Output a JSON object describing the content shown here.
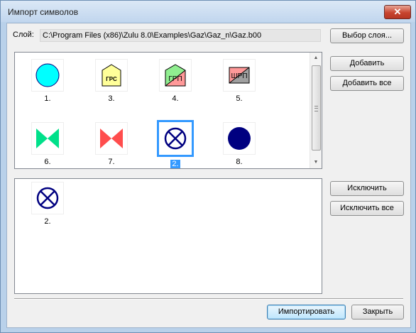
{
  "window": {
    "title": "Импорт символов",
    "close_glyph": "✕"
  },
  "layer": {
    "label": "Слой:",
    "path": "C:\\Program Files (x86)\\Zulu 8.0\\Examples\\Gaz\\Gaz_n\\Gaz.b00",
    "choose_button": "Выбор слоя..."
  },
  "buttons": {
    "add": "Добавить",
    "add_all": "Добавить все",
    "exclude": "Исключить",
    "exclude_all": "Исключить все",
    "import": "Импортировать",
    "close": "Закрыть"
  },
  "available_symbols": [
    {
      "label": "1.",
      "icon": "cyan-circle-icon",
      "color": "#00ffff"
    },
    {
      "label": "3.",
      "icon": "grs-house-icon",
      "text": "ГРС",
      "color": "#ffff99"
    },
    {
      "label": "4.",
      "icon": "grp-house-icon",
      "text": "ГРП",
      "colors": [
        "#90ee90",
        "#ff9999"
      ]
    },
    {
      "label": "5.",
      "icon": "shrp-box-icon",
      "text": "ШРП",
      "colors": [
        "#ff9999",
        "#a0a0a0"
      ]
    },
    {
      "label": "6.",
      "icon": "green-valve-icon",
      "color": "#00e08a"
    },
    {
      "label": "7.",
      "icon": "red-valve-icon",
      "color": "#ff4d4d"
    },
    {
      "label": "2.",
      "icon": "crossed-circle-icon",
      "color": "#000080",
      "selected": true
    },
    {
      "label": "8.",
      "icon": "navy-circle-icon",
      "color": "#000080"
    }
  ],
  "selected_symbols": [
    {
      "label": "2.",
      "icon": "crossed-circle-icon",
      "color": "#000080"
    }
  ],
  "colors": {
    "selection": "#3399ff"
  }
}
